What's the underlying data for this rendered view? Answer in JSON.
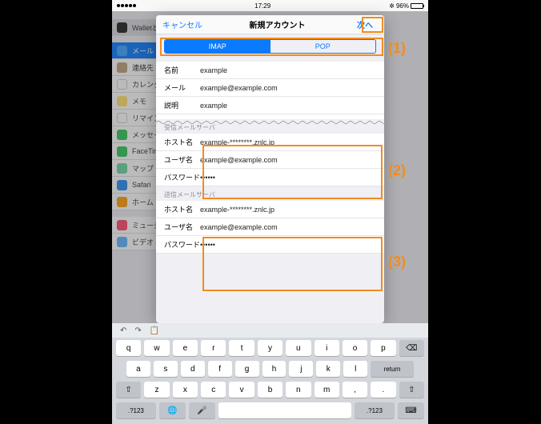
{
  "status": {
    "time": "17:29",
    "battery": "96%",
    "carrier": "•••••"
  },
  "navbar": {
    "cancel": "キャンセル",
    "title": "新規アカウント",
    "next": "次へ"
  },
  "segments": {
    "imap": "IMAP",
    "pop": "POP"
  },
  "account": {
    "name_label": "名前",
    "name_value": "example",
    "mail_label": "メール",
    "mail_value": "example@example.com",
    "desc_label": "説明",
    "desc_value": "example"
  },
  "incoming_header": "受信メールサーバ",
  "incoming": {
    "host_label": "ホスト名",
    "host_value": "example-********.znlc.jp",
    "user_label": "ユーザ名",
    "user_value": "example@example.com",
    "pass_label": "パスワード",
    "pass_value": "••••••"
  },
  "outgoing_header": "送信メールサーバ",
  "outgoing": {
    "host_label": "ホスト名",
    "host_value": "example-********.znlc.jp",
    "user_label": "ユーザ名",
    "user_value": "example@example.com",
    "pass_label": "パスワード",
    "pass_value": "••••••"
  },
  "rail": {
    "wallet": "Walletと",
    "mail": "メール",
    "contacts": "連絡先",
    "calendar": "カレンダ",
    "notes": "メモ",
    "reminders": "リマイン",
    "messages": "メッセー",
    "facetime": "FaceTime",
    "maps": "マップ",
    "safari": "Safari",
    "home": "ホーム",
    "music": "ミュージ",
    "video": "ビデオ"
  },
  "keys": {
    "row1": [
      "q",
      "w",
      "e",
      "r",
      "t",
      "y",
      "u",
      "i",
      "o",
      "p"
    ],
    "row2": [
      "a",
      "s",
      "d",
      "f",
      "g",
      "h",
      "j",
      "k",
      "l"
    ],
    "row3": [
      "z",
      "x",
      "c",
      "v",
      "b",
      "n",
      "m",
      ",",
      "."
    ],
    "shift": "⇧",
    "back": "⌫",
    "numkey": ".?123",
    "return": "return",
    "globe": "🌐",
    "mic": "🎤"
  },
  "annotations": {
    "a1": "(1)",
    "a2": "(2)",
    "a3": "(3)"
  }
}
